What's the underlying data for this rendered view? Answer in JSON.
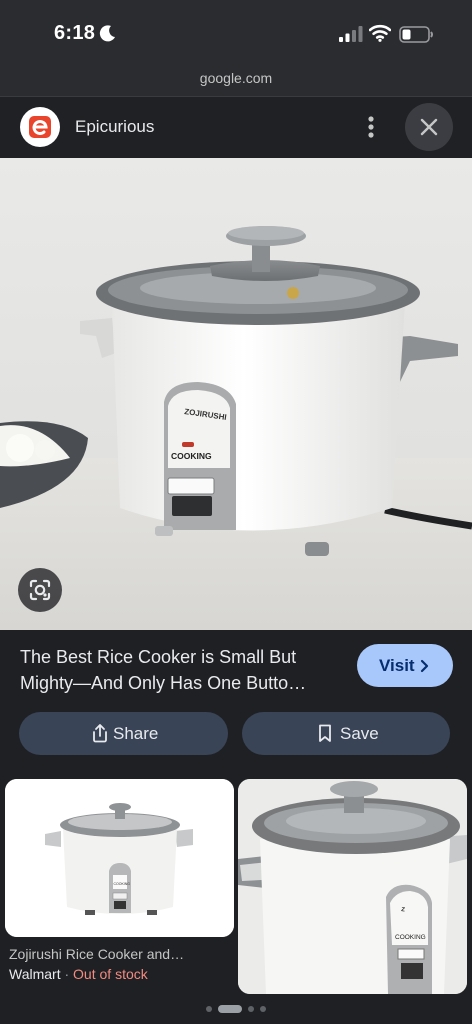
{
  "status_bar": {
    "time": "6:18"
  },
  "url_bar": {
    "domain": "google.com"
  },
  "header": {
    "site_name": "Epicurious",
    "logo_letter": "e",
    "logo_color": "#e8452c"
  },
  "main_image": {
    "description_icon": "rice-cooker-photo",
    "cooker_brand_text": "ZOJIRUSHI",
    "cooker_indicator_text": "COOKING"
  },
  "result": {
    "title": "The Best Rice Cooker is Small But Mighty—And Only Has One Butto…",
    "visit_label": "Visit"
  },
  "actions": {
    "share_label": "Share",
    "save_label": "Save"
  },
  "related": [
    {
      "title": "Zojirushi Rice Cooker and…",
      "merchant": "Walmart",
      "separator": "·",
      "stock": "Out of stock",
      "cooker_text": "COOKING"
    },
    {
      "cooker_text": "COOKING"
    }
  ],
  "pagination": {
    "count": 4,
    "active_index": 1
  },
  "colors": {
    "visit_bg": "#a8c7fa",
    "action_bg": "#394457",
    "out_of_stock": "#f28b82"
  }
}
